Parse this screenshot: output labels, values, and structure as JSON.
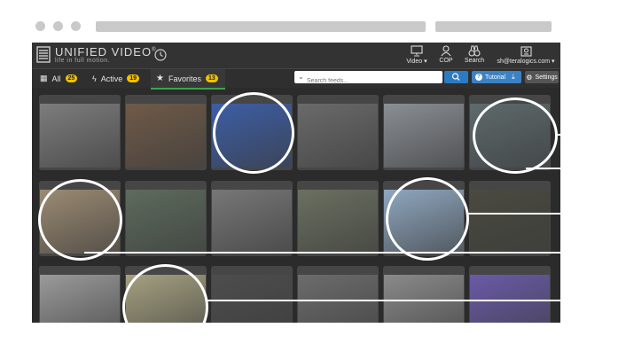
{
  "app": {
    "title": "UNIFIED VIDEO",
    "trademark": "®",
    "tagline": "life in full motion."
  },
  "nav": {
    "video": "Video ▾",
    "cop": "COP",
    "search": "Search",
    "user": "sh@teralogics.com ▾"
  },
  "tabs": [
    {
      "label": "All",
      "count": "25"
    },
    {
      "label": "Active",
      "count": "19"
    },
    {
      "label": "Favorites",
      "count": "13"
    }
  ],
  "search": {
    "placeholder": "Search feeds..."
  },
  "buttons": {
    "tutorial": "Tutorial",
    "settings": "Settings"
  },
  "feeds": [
    {
      "name": "feed-smoke-aerial",
      "bg": "#7d7d7d"
    },
    {
      "name": "feed-firefighter",
      "bg": "#6f5a48"
    },
    {
      "name": "feed-harbor-aerial",
      "bg": "#3d5ea6"
    },
    {
      "name": "feed-field-thermal",
      "bg": "#6a6a6a"
    },
    {
      "name": "feed-helicopter",
      "bg": "#8a8f95"
    },
    {
      "name": "feed-road-night",
      "bg": "#5e6a6c"
    },
    {
      "name": "feed-beach-dog",
      "bg": "#9b8a72"
    },
    {
      "name": "feed-neighborhood-aerial",
      "bg": "#5d6b5d"
    },
    {
      "name": "feed-stadium-aerial",
      "bg": "#777"
    },
    {
      "name": "feed-highway-aerial",
      "bg": "#6b7060"
    },
    {
      "name": "feed-snow-road",
      "bg": "#8fa7c0"
    },
    {
      "name": "feed-river-aerial",
      "bg": "#4a4a40"
    },
    {
      "name": "feed-buildings-gray",
      "bg": "#9a9a9a"
    },
    {
      "name": "feed-winter-trees",
      "bg": "#a5a080"
    },
    {
      "name": "feed-thermal-town",
      "bg": "#4d4d4d"
    },
    {
      "name": "feed-gray-aerial",
      "bg": "#6c6c6c"
    },
    {
      "name": "feed-rooftops-aerial",
      "bg": "#8a8a8a"
    },
    {
      "name": "feed-warehouse-purple",
      "bg": "#6a5aa8"
    }
  ]
}
